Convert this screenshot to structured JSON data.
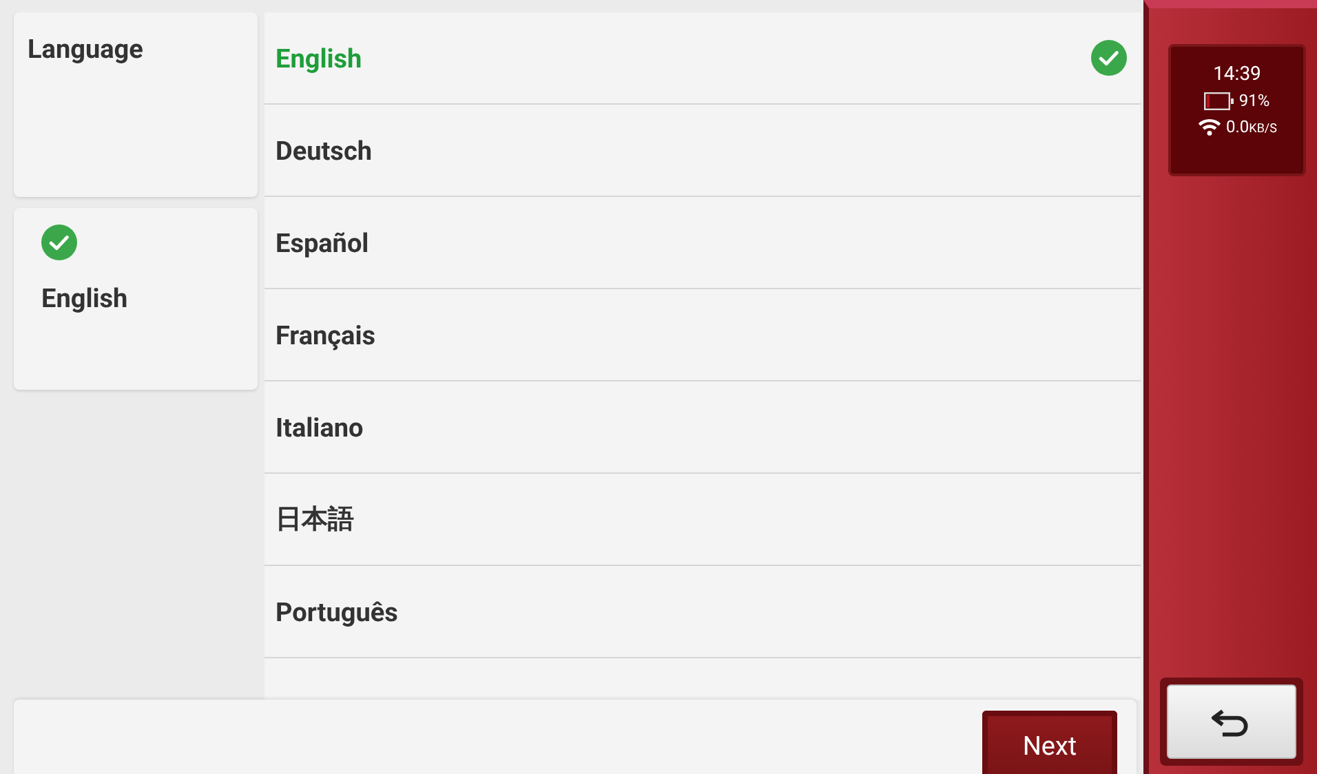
{
  "sidebar": {
    "title": "Language",
    "current": {
      "label": "English"
    }
  },
  "languages": [
    {
      "label": "English",
      "selected": true
    },
    {
      "label": "Deutsch",
      "selected": false
    },
    {
      "label": "Español",
      "selected": false
    },
    {
      "label": "Français",
      "selected": false
    },
    {
      "label": "Italiano",
      "selected": false
    },
    {
      "label": "日本語",
      "selected": false
    },
    {
      "label": "Português",
      "selected": false
    }
  ],
  "footer": {
    "next_button": "Next"
  },
  "status": {
    "time": "14:39",
    "battery": "91%",
    "speed": "0.0",
    "speed_unit": "KB/S"
  }
}
